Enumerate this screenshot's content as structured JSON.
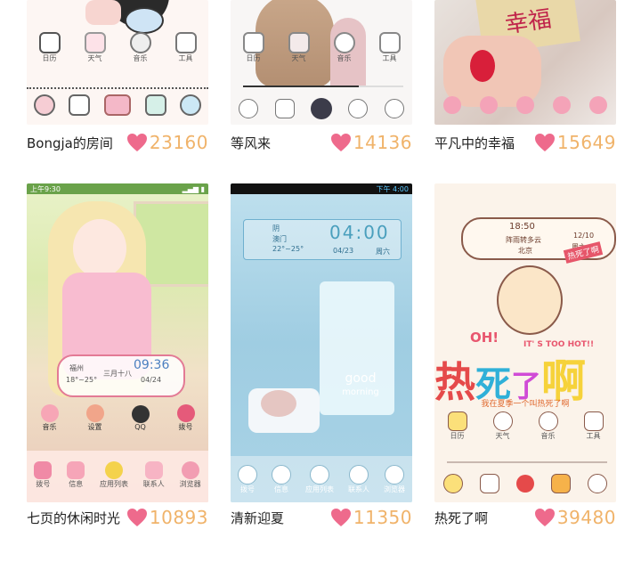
{
  "cards": [
    {
      "name": "Bongja的房间",
      "likes": "23160",
      "dock_labels": [
        "日历",
        "天气",
        "音乐",
        "工具"
      ]
    },
    {
      "name": "等风来",
      "likes": "14136",
      "dock_labels": [
        "日历",
        "天气",
        "音乐",
        "工具"
      ]
    },
    {
      "name": "平凡中的幸福",
      "likes": "15649",
      "sign_text": "幸福"
    },
    {
      "name": "七页的休闲时光",
      "likes": "10893",
      "status_time": "上午9:30",
      "widget": {
        "time": "09:36",
        "city": "福州",
        "temp": "18°~25°",
        "date": "三月十八",
        "day": "04/24"
      },
      "icons_row1": [
        "音乐",
        "设置",
        "QQ",
        "拨号"
      ],
      "icons_row2": [
        "拨号",
        "信息",
        "应用列表",
        "联系人",
        "浏览器"
      ]
    },
    {
      "name": "清新迎夏",
      "likes": "11350",
      "status_time": "下午 4:00",
      "widget": {
        "time": "04:00",
        "weather": "阴",
        "city": "澳门",
        "temp": "22°~25°",
        "date": "04/23",
        "day": "周六"
      },
      "cup_text": [
        "good",
        "morning"
      ],
      "icons": [
        "拨号",
        "信息",
        "应用列表",
        "联系人",
        "浏览器"
      ]
    },
    {
      "name": "热死了啊",
      "likes": "39480",
      "widget": {
        "time": "18:50",
        "weather": "阵雨转多云",
        "city": "北京",
        "date": "12/10",
        "day": "周六",
        "tag": "热死了啊"
      },
      "banner_small": "OH!",
      "banner_right": "IT' S TOO HOT!!",
      "big_chars": [
        "热",
        "死",
        "了",
        "啊"
      ],
      "subline": "我在夏季一个叫热死了啊",
      "labels": [
        "日历",
        "天气",
        "音乐",
        "工具"
      ]
    }
  ],
  "colors": {
    "heart": "#ee6a8c",
    "count": "#f0b36a",
    "pink": "#f4b8c8"
  }
}
